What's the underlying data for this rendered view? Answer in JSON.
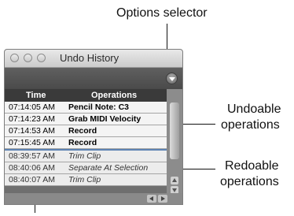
{
  "callouts": {
    "options_selector": "Options selector",
    "undoable_line1": "Undoable",
    "undoable_line2": "operations",
    "redoable_line1": "Redoable",
    "redoable_line2": "operations"
  },
  "window": {
    "title": "Undo History",
    "options_icon": "chevron-down-icon",
    "columns": {
      "time": "Time",
      "operations": "Operations"
    },
    "undo_rows": [
      {
        "time": "07:14:05 AM",
        "operation": "Pencil Note: C3"
      },
      {
        "time": "07:14:23 AM",
        "operation": "Grab MIDI Velocity"
      },
      {
        "time": "07:14:53 AM",
        "operation": "Record"
      },
      {
        "time": "07:15:45 AM",
        "operation": "Record"
      }
    ],
    "redo_rows": [
      {
        "time": "08:39:57 AM",
        "operation": "Trim Clip"
      },
      {
        "time": "08:40:06 AM",
        "operation": "Separate At Selection"
      },
      {
        "time": "08:40:07 AM",
        "operation": "Trim Clip"
      }
    ]
  },
  "colors": {
    "undo_row_bg": "#f4f4f4",
    "redo_row_bg": "#ececec",
    "separator": "#5d83b3"
  }
}
